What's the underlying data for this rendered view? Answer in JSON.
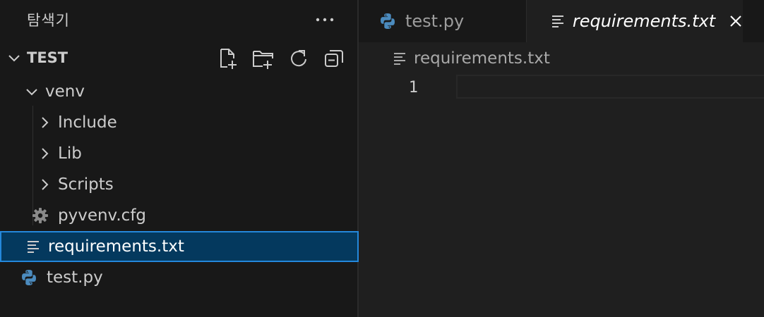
{
  "explorer": {
    "title": "탐색기",
    "more_icon": "ellipsis-icon",
    "section": {
      "title": "TEST",
      "actions": [
        "new-file-icon",
        "new-folder-icon",
        "refresh-icon",
        "collapse-all-icon"
      ]
    },
    "tree": {
      "venv": "venv",
      "include": "Include",
      "lib": "Lib",
      "scripts": "Scripts",
      "pyvenv": "pyvenv.cfg",
      "requirements": "requirements.txt",
      "testpy": "test.py"
    }
  },
  "editor": {
    "tabs": [
      {
        "label": "test.py",
        "icon": "python-icon",
        "active": false
      },
      {
        "label": "requirements.txt",
        "icon": "text-file-icon",
        "active": true
      }
    ],
    "breadcrumb": "requirements.txt",
    "line_number": "1"
  },
  "colors": {
    "selection_bg": "#04395e",
    "selection_border": "#2488db",
    "python_blue": "#4b8bbe",
    "python_yellow": "#ffd43b"
  }
}
